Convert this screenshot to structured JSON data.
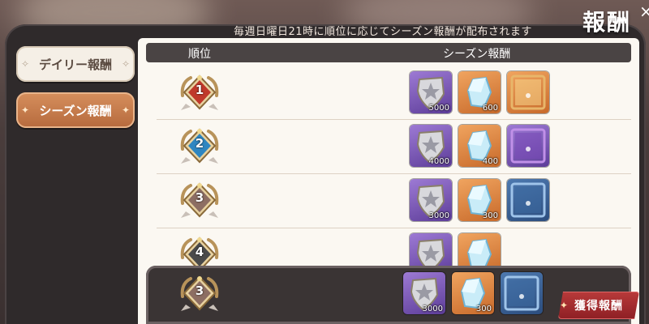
{
  "title": "報酬",
  "close_label": "×",
  "notice": "毎週日曜日21時に順位に応じてシーズン報酬が配布されます",
  "tabs": [
    {
      "label": "デイリー報酬",
      "active": false
    },
    {
      "label": "シーズン報酬",
      "active": true
    }
  ],
  "table_header": {
    "rank": "順位",
    "reward": "シーズン報酬"
  },
  "rows": [
    {
      "rank": "1",
      "medal_color": "#c0392b",
      "rewards": [
        {
          "kind": "shield",
          "count": "5000"
        },
        {
          "kind": "crystal",
          "count": "600"
        },
        {
          "kind": "frame-gold",
          "count": ""
        }
      ]
    },
    {
      "rank": "2",
      "medal_color": "#2e86c1",
      "rewards": [
        {
          "kind": "shield",
          "count": "4000"
        },
        {
          "kind": "crystal",
          "count": "400"
        },
        {
          "kind": "frame-purple",
          "count": ""
        }
      ]
    },
    {
      "rank": "3",
      "medal_color": "#8d6e63",
      "rewards": [
        {
          "kind": "shield",
          "count": "3000"
        },
        {
          "kind": "crystal",
          "count": "300"
        },
        {
          "kind": "frame-blue",
          "count": ""
        }
      ]
    },
    {
      "rank": "4",
      "medal_color": "#4a4a4a",
      "rewards": [
        {
          "kind": "shield",
          "count": ""
        },
        {
          "kind": "crystal",
          "count": ""
        }
      ]
    }
  ],
  "my_rank": {
    "rank": "3",
    "rewards": [
      {
        "kind": "shield",
        "count": "3000"
      },
      {
        "kind": "crystal",
        "count": "300"
      },
      {
        "kind": "frame-blue",
        "count": ""
      }
    ]
  },
  "claim_button": "獲得報酬",
  "colors": {
    "accent": "#b66a3d",
    "claim": "#a12a2e",
    "header": "#4a4444"
  }
}
